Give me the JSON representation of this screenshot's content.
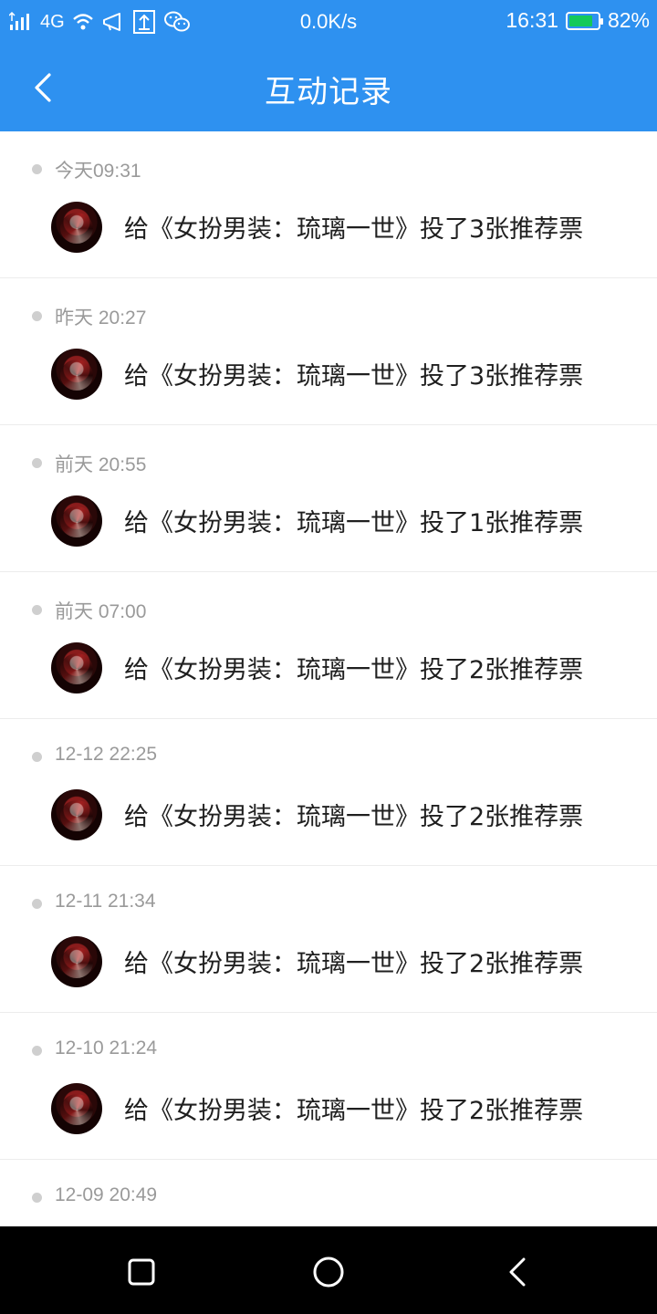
{
  "status_bar": {
    "network_type": "4G",
    "speed": "0.0K/s",
    "time": "16:31",
    "battery_level": "82%",
    "battery_fraction": 0.82,
    "battery_color": "#14c95a"
  },
  "header": {
    "title": "互动记录",
    "background_color": "#2e91f0"
  },
  "records": [
    {
      "time": "今天09:31",
      "message": "给《女扮男装：琉璃一世》投了3张推荐票"
    },
    {
      "time": "昨天 20:27",
      "message": "给《女扮男装：琉璃一世》投了3张推荐票"
    },
    {
      "time": "前天 20:55",
      "message": "给《女扮男装：琉璃一世》投了1张推荐票"
    },
    {
      "time": "前天 07:00",
      "message": "给《女扮男装：琉璃一世》投了2张推荐票"
    },
    {
      "time": "12-12 22:25",
      "message": "给《女扮男装：琉璃一世》投了2张推荐票"
    },
    {
      "time": "12-11 21:34",
      "message": "给《女扮男装：琉璃一世》投了2张推荐票"
    },
    {
      "time": "12-10 21:24",
      "message": "给《女扮男装：琉璃一世》投了2张推荐票"
    },
    {
      "time": "12-09 20:49",
      "message": ""
    }
  ],
  "icons": {
    "back": "chevron-left-icon",
    "nav_recent": "square-icon",
    "nav_home": "circle-icon",
    "nav_back": "triangle-back-icon"
  }
}
